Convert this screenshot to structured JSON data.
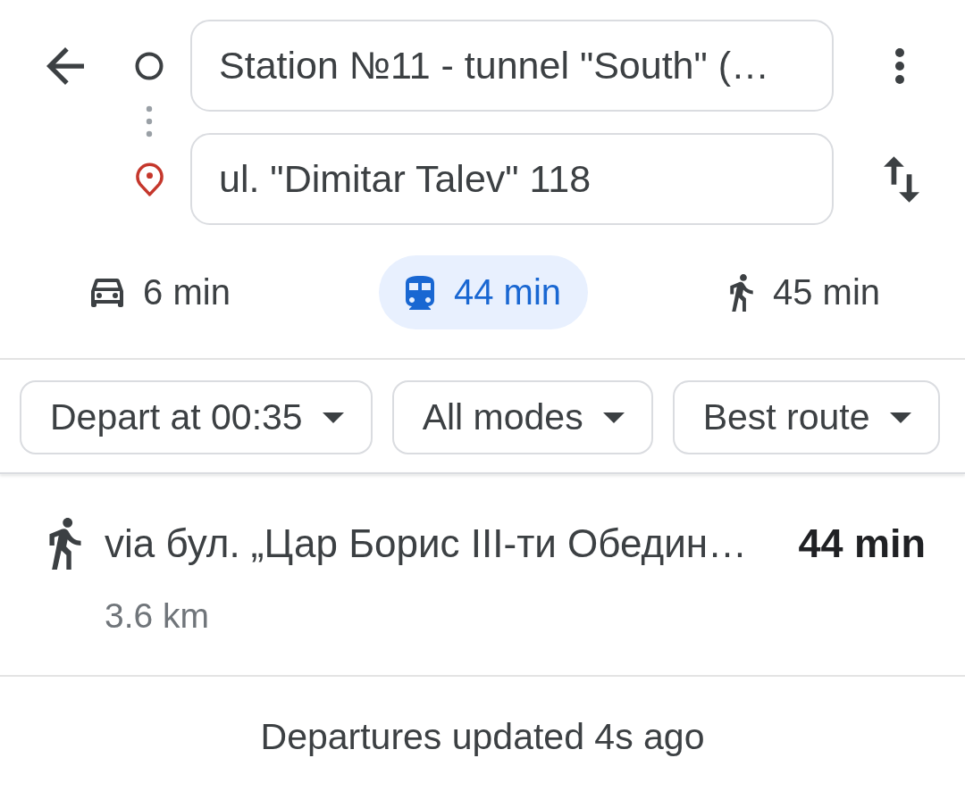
{
  "route_inputs": [
    {
      "kind": "origin",
      "value": "Station №11 - tunnel \"South\" (…"
    },
    {
      "kind": "destination",
      "value": "ul. \"Dimitar Talev\" 118"
    }
  ],
  "travel_modes": [
    {
      "kind": "car",
      "label": "6 min",
      "selected": false
    },
    {
      "kind": "transit",
      "label": "44 min",
      "selected": true
    },
    {
      "kind": "walk",
      "label": "45 min",
      "selected": false
    }
  ],
  "filters": [
    {
      "label": "Depart at 00:35"
    },
    {
      "label": "All modes"
    },
    {
      "label": "Best route"
    }
  ],
  "routes": [
    {
      "kind": "walk",
      "summary": "via бул. „Цар Борис III-ти Обедин…",
      "duration": "44 min",
      "distance": "3.6 km"
    }
  ],
  "footer": {
    "status": "Departures updated 4s ago"
  }
}
